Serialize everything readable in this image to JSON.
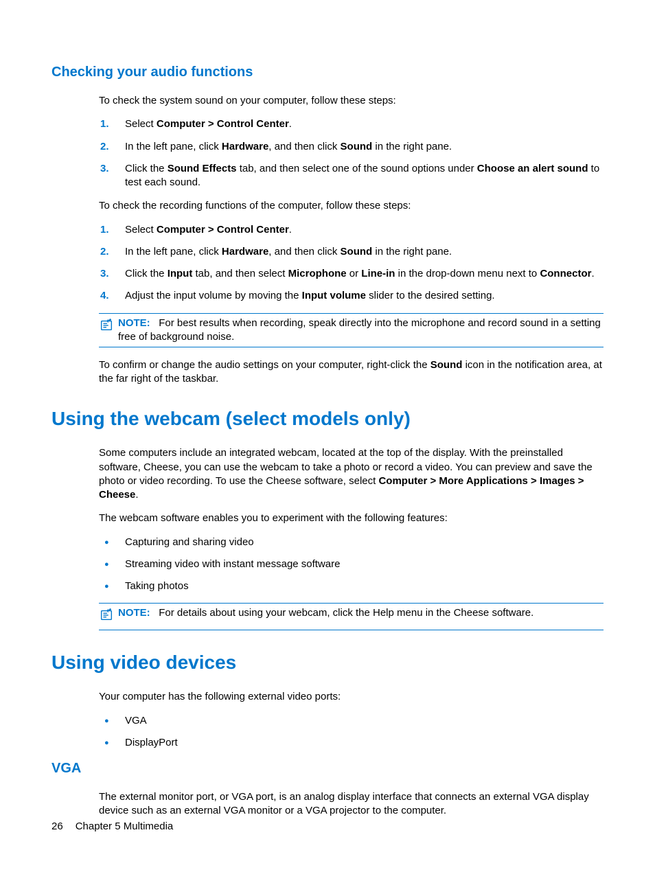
{
  "section1": {
    "heading": "Checking your audio functions",
    "intro1": "To check the system sound on your computer, follow these steps:",
    "list1": {
      "n1": "1.",
      "t1_a": "Select ",
      "t1_b": "Computer > Control Center",
      "t1_c": ".",
      "n2": "2.",
      "t2_a": "In the left pane, click ",
      "t2_b": "Hardware",
      "t2_c": ", and then click ",
      "t2_d": "Sound",
      "t2_e": " in the right pane.",
      "n3": "3.",
      "t3_a": "Click the ",
      "t3_b": "Sound Effects",
      "t3_c": " tab, and then select one of the sound options under ",
      "t3_d": "Choose an alert sound",
      "t3_e": " to test each sound."
    },
    "intro2": "To check the recording functions of the computer, follow these steps:",
    "list2": {
      "n1": "1.",
      "t1_a": "Select ",
      "t1_b": "Computer > Control Center",
      "t1_c": ".",
      "n2": "2.",
      "t2_a": "In the left pane, click ",
      "t2_b": "Hardware",
      "t2_c": ", and then click ",
      "t2_d": "Sound",
      "t2_e": " in the right pane.",
      "n3": "3.",
      "t3_a": "Click the ",
      "t3_b": "Input",
      "t3_c": " tab, and then select ",
      "t3_d": "Microphone",
      "t3_e": " or ",
      "t3_f": "Line-in",
      "t3_g": " in the drop-down menu next to ",
      "t3_h": "Connector",
      "t3_i": ".",
      "n4": "4.",
      "t4_a": "Adjust the input volume by moving the ",
      "t4_b": "Input volume",
      "t4_c": " slider to the desired setting."
    },
    "note1_label": "NOTE:",
    "note1_text": "For best results when recording, speak directly into the microphone and record sound in a setting free of background noise.",
    "para_after_note_a": "To confirm or change the audio settings on your computer, right-click the ",
    "para_after_note_b": "Sound",
    "para_after_note_c": " icon in the notification area, at the far right of the taskbar."
  },
  "section2": {
    "heading": "Using the webcam (select models only)",
    "para1_a": "Some computers include an integrated webcam, located at the top of the display. With the preinstalled software, Cheese, you can use the webcam to take a photo or record a video. You can preview and save the photo or video recording. To use the Cheese software, select ",
    "para1_b": "Computer > More Applications > Images > Cheese",
    "para1_c": ".",
    "para2": "The webcam software enables you to experiment with the following features:",
    "bullets": {
      "b1": "Capturing and sharing video",
      "b2": "Streaming video with instant message software",
      "b3": "Taking photos"
    },
    "note_label": "NOTE:",
    "note_text": "For details about using your webcam, click the Help menu in the Cheese software."
  },
  "section3": {
    "heading": "Using video devices",
    "para1": "Your computer has the following external video ports:",
    "bullets": {
      "b1": "VGA",
      "b2": "DisplayPort"
    },
    "sub_heading": "VGA",
    "sub_para": "The external monitor port, or VGA port, is an analog display interface that connects an external VGA display device such as an external VGA monitor or a VGA projector to the computer."
  },
  "footer": {
    "page": "26",
    "chapter": "Chapter 5   Multimedia"
  }
}
